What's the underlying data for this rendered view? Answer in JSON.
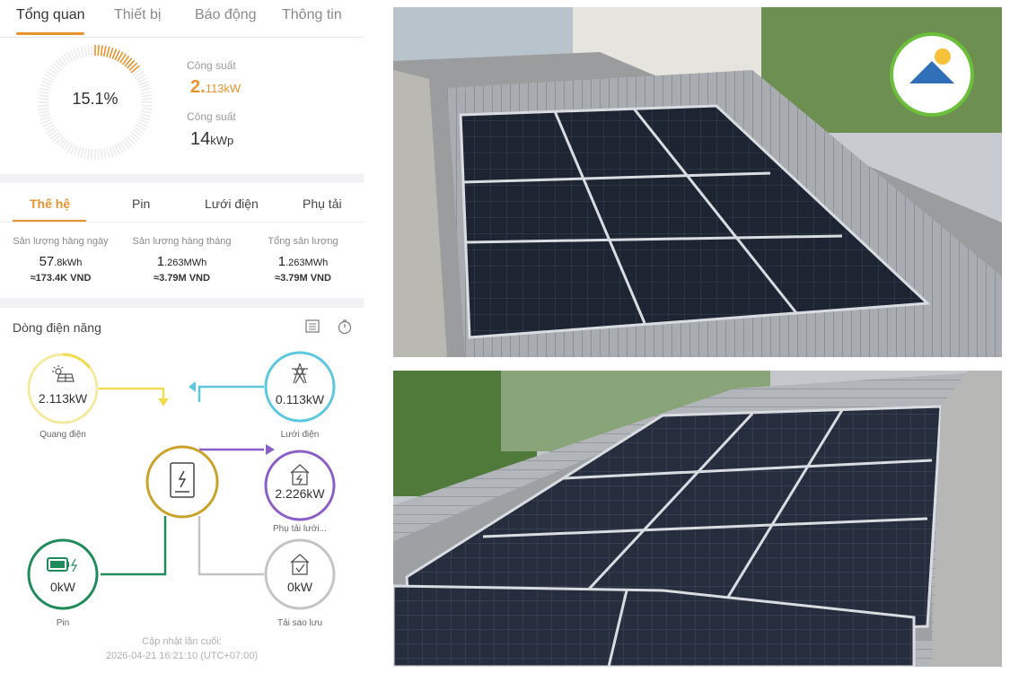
{
  "tabs": [
    "Tổng quan",
    "Thiết bị",
    "Báo động",
    "Thông tin"
  ],
  "summary": {
    "gauge_percent": 15.1,
    "gauge_text": "15.1%",
    "power_label": "Công suất",
    "power_value": "2.",
    "power_value2": "113",
    "power_unit": "kW",
    "capacity_label": "Công suất",
    "capacity_value": "14",
    "capacity_unit": "kWp"
  },
  "energy": {
    "tabs": [
      "Thế hệ",
      "Pin",
      "Lưới điện",
      "Phụ tải"
    ],
    "stats": [
      {
        "label": "Sản lượng hàng ngày",
        "value_main": "57",
        "value_small": ".8kWh",
        "vnd": "≈173.4K VND"
      },
      {
        "label": "Sản lượng hàng tháng",
        "value_main": "1",
        "value_small": ".263MWh",
        "vnd": "≈3.79M VND"
      },
      {
        "label": "Tổng sản lượng",
        "value_main": "1",
        "value_small": ".263MWh",
        "vnd": "≈3.79M VND"
      }
    ]
  },
  "flow": {
    "title": "Dòng điện năng",
    "nodes": {
      "pv": {
        "value": "2.113kW",
        "caption": "Quang điện"
      },
      "grid": {
        "value": "0.113kW",
        "caption": "Lưới điện"
      },
      "load": {
        "value": "2.226kW",
        "caption": "Phụ tải lưới..."
      },
      "battery": {
        "value": "0kW",
        "caption": "Pin"
      },
      "backup": {
        "value": "0kW",
        "caption": "Tải sao lưu"
      }
    },
    "updated_label": "Cập nhật lần cuối:",
    "updated_value": "2026-04-21 16:21:10 (UTC+07:00)"
  },
  "colors": {
    "accent": "#e8932f",
    "pv": "#f0dc50",
    "grid": "#5bc8e0",
    "load": "#8a5fc8",
    "battery": "#1f8a5a",
    "inverter": "#c9a227",
    "backup": "#c4c4c4"
  }
}
